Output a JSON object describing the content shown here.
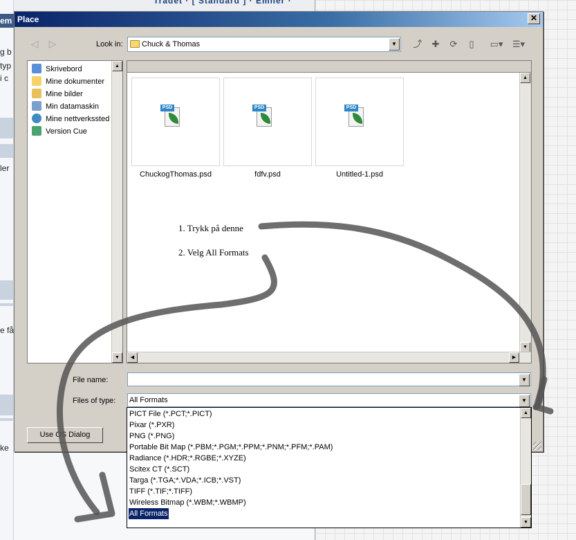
{
  "background": {
    "top_links": "Trådet · [ Standard ] · Emner ·",
    "left_fragments": [
      "em",
      "g b",
      "typ",
      "i c",
      "ler",
      "e få",
      "ke"
    ]
  },
  "dialog": {
    "title": "Place",
    "close": "✕",
    "look_in_label": "Look in:",
    "look_in_value": "Chuck & Thomas",
    "places": [
      "Skrivebord",
      "Mine dokumenter",
      "Mine bilder",
      "Min datamaskin",
      "Mine nettverkssted",
      "Version Cue"
    ],
    "files": [
      "ChuckogThomas.psd",
      "fdfv.psd",
      "Untitled-1.psd"
    ],
    "psd_tag": "PSD",
    "annotations": [
      "1.  Trykk på denne",
      "2. Velg All Formats"
    ],
    "file_name_label": "File name:",
    "file_name_value": "",
    "files_of_type_label": "Files of type:",
    "files_of_type_value": "All Formats",
    "use_os_dialog": "Use OS Dialog"
  },
  "dropdown_options": [
    "PICT File (*.PCT;*.PICT)",
    "Pixar (*.PXR)",
    "PNG (*.PNG)",
    "Portable Bit Map (*.PBM;*.PGM;*.PPM;*.PNM;*.PFM;*.PAM)",
    "Radiance (*.HDR;*.RGBE;*.XYZE)",
    "Scitex CT (*.SCT)",
    "Targa (*.TGA;*.VDA;*.ICB;*.VST)",
    "TIFF (*.TIF;*.TIFF)",
    "Wireless Bitmap (*.WBM;*.WBMP)",
    "All Formats"
  ],
  "colors": {
    "title_gradient_start": "#0a246a",
    "selection": "#0a246a",
    "annotation_stroke": "#555555"
  }
}
